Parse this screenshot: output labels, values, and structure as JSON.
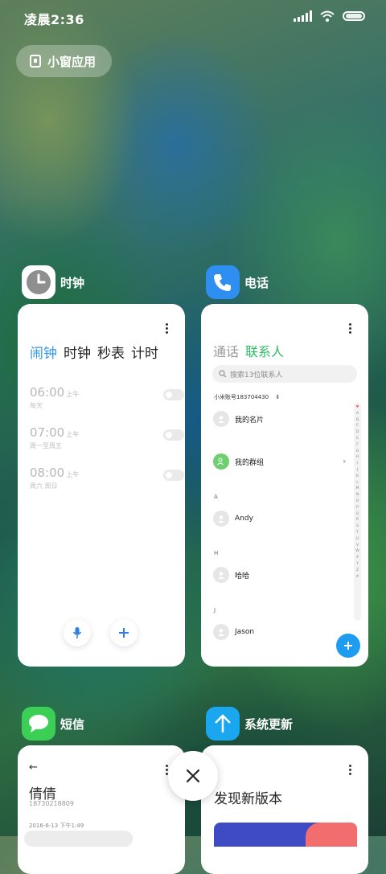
{
  "status_bar": {
    "time": "凌晨2:36"
  },
  "floating_window": {
    "label": "小窗应用"
  },
  "apps": {
    "clock": {
      "name": "时钟",
      "tabs": [
        "闹钟",
        "时钟",
        "秒表",
        "计时"
      ],
      "alarms": [
        {
          "time": "06:00",
          "ampm": "上午",
          "repeat": "每天",
          "enabled": false
        },
        {
          "time": "07:00",
          "ampm": "上午",
          "repeat": "周一至周五",
          "enabled": false
        },
        {
          "time": "08:00",
          "ampm": "上午",
          "repeat": "周六 周日",
          "enabled": false
        }
      ]
    },
    "phone": {
      "name": "电话",
      "tabs": [
        "通话",
        "联系人"
      ],
      "search_placeholder": "搜索13位联系人",
      "account": "小米账号183704430",
      "my_card": "我的名片",
      "my_groups": "我的群组",
      "sections": [
        {
          "letter": "A",
          "name": "Andy"
        },
        {
          "letter": "H",
          "name": "哈哈"
        },
        {
          "letter": "J",
          "name": "Jason"
        }
      ],
      "index_letters": [
        "♥",
        "A",
        "B",
        "C",
        "D",
        "E",
        "F",
        "G",
        "H",
        "I",
        "J",
        "K",
        "L",
        "M",
        "N",
        "O",
        "P",
        "Q",
        "R",
        "S",
        "T",
        "U",
        "V",
        "W",
        "X",
        "Y",
        "Z",
        "#"
      ]
    },
    "sms": {
      "name": "短信",
      "contact": "倩倩",
      "number": "18730218809",
      "date": "2016-6-13 下午1:49"
    },
    "update": {
      "name": "系统更新",
      "title": "发现新版本"
    }
  },
  "colors": {
    "accent_blue": "#2f96e9",
    "contact_green": "#2fbc66",
    "fab_blue": "#1e9cf0",
    "sms_green": "#3ccf56",
    "update_blue": "#1aa7f0",
    "phone_blue": "#2f8ff0"
  }
}
